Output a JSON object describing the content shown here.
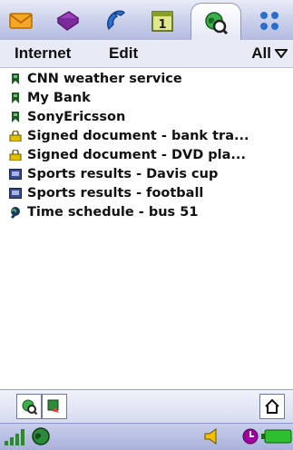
{
  "app_tabs": [
    {
      "icon": "messaging-envelope-icon"
    },
    {
      "icon": "contacts-book-icon"
    },
    {
      "icon": "phone-handset-icon"
    },
    {
      "icon": "calendar-icon",
      "text": "1"
    },
    {
      "icon": "internet-globe-icon",
      "active": true
    },
    {
      "icon": "applications-grid-icon"
    }
  ],
  "menu": {
    "internet_label": "Internet",
    "edit_label": "Edit",
    "filter_value": "All"
  },
  "bookmarks": [
    {
      "label": "CNN weather service",
      "icon": "bookmark-icon"
    },
    {
      "label": "My Bank",
      "icon": "bookmark-icon"
    },
    {
      "label": "SonyEricsson",
      "icon": "bookmark-icon"
    },
    {
      "label": "Signed document - bank tra...",
      "icon": "signed-document-icon"
    },
    {
      "label": "Signed document - DVD pla...",
      "icon": "signed-document-icon"
    },
    {
      "label": "Sports results - Davis cup",
      "icon": "saved-page-icon"
    },
    {
      "label": "Sports results - football",
      "icon": "saved-page-icon"
    },
    {
      "label": "Time schedule - bus 51",
      "icon": "web-link-icon"
    }
  ],
  "colors": {
    "accent": "#b4bbe0",
    "bookmark": "#1f7a2a",
    "signed": "#e0c000",
    "battery": "#2fbf2f",
    "speaker": "#f0c000",
    "clock": "#a000a0"
  }
}
